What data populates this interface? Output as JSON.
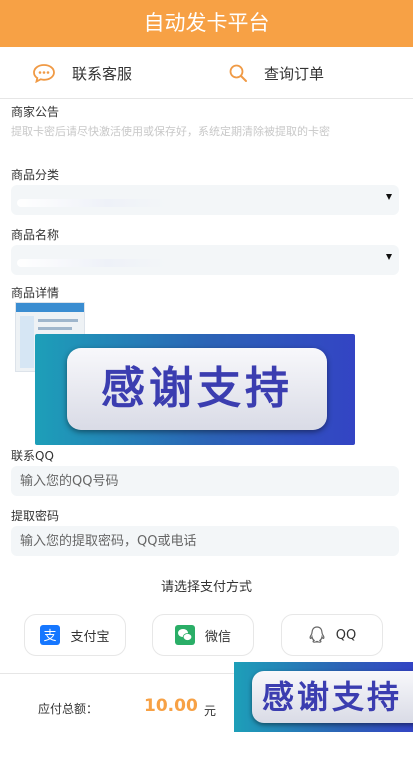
{
  "header": {
    "title": "自动发卡平台"
  },
  "nav": {
    "service_label": "联系客服",
    "query_label": "查询订单"
  },
  "notice": {
    "label": "商家公告",
    "text": "提取卡密后请尽快激活使用或保存好，系统定期清除被提取的卡密"
  },
  "category": {
    "label": "商品分类"
  },
  "product": {
    "label": "商品名称"
  },
  "details": {
    "label": "商品详情",
    "banner_text": "感谢支持"
  },
  "contact": {
    "label": "联系QQ",
    "placeholder": "输入您的QQ号码"
  },
  "password": {
    "label": "提取密码",
    "placeholder": "输入您的提取密码，QQ或电话"
  },
  "payment": {
    "title": "请选择支付方式",
    "methods": [
      {
        "label": "支付宝",
        "icon": "alipay-icon",
        "color": "#1677ff"
      },
      {
        "label": "微信",
        "icon": "wechat-icon",
        "color": "#2aae67"
      },
      {
        "label": "QQ",
        "icon": "qq-icon",
        "color": "#555555"
      }
    ]
  },
  "footer": {
    "total_label": "应付总额：",
    "total_value": "10.00",
    "unit": "元",
    "buy_banner_text": "感谢支持"
  },
  "colors": {
    "accent": "#f7a145"
  }
}
